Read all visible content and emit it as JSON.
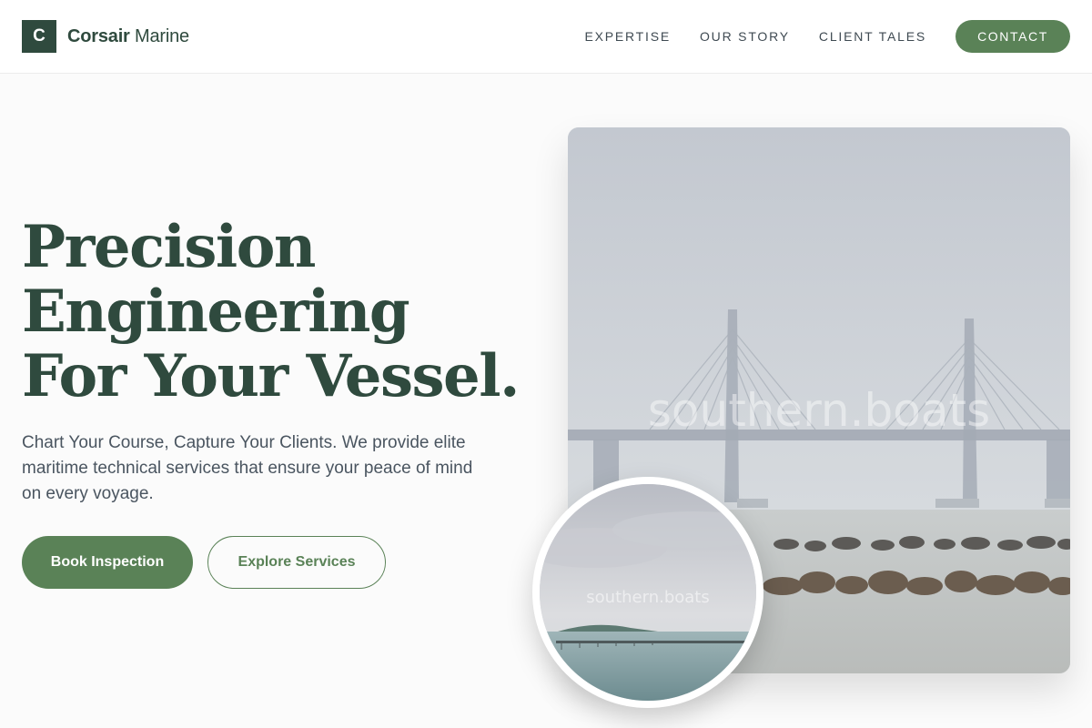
{
  "brand": {
    "mark": "C",
    "name_bold": "Corsair",
    "name_light": " Marine"
  },
  "nav": {
    "links": [
      "EXPERTISE",
      "OUR STORY",
      "CLIENT TALES"
    ],
    "cta": "CONTACT"
  },
  "hero": {
    "title_lines": [
      "Precision",
      "Engineering",
      "For Your Vessel."
    ],
    "subtitle": "Chart Your Course, Capture Your Clients. We provide elite maritime technical services that ensure your peace of mind on every voyage.",
    "primary_button": "Book Inspection",
    "secondary_button": "Explore Services"
  },
  "images": {
    "main_watermark": "southern.boats",
    "circle_watermark": "southern.boats"
  },
  "colors": {
    "brand_dark": "#2f4a3e",
    "accent_green": "#5a8257",
    "background": "#fbfbfb"
  }
}
